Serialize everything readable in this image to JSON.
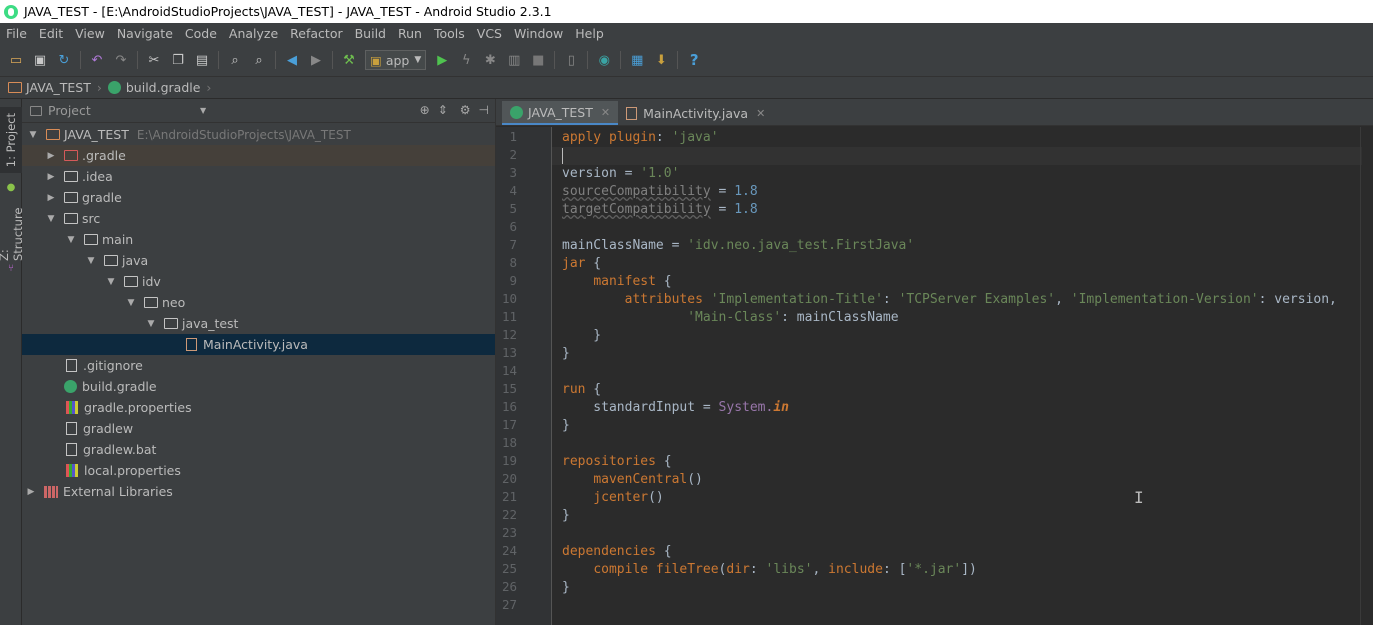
{
  "window": {
    "title": "JAVA_TEST - [E:\\AndroidStudioProjects\\JAVA_TEST] - JAVA_TEST - Android Studio 2.3.1"
  },
  "menu": [
    "File",
    "Edit",
    "View",
    "Navigate",
    "Code",
    "Analyze",
    "Refactor",
    "Build",
    "Run",
    "Tools",
    "VCS",
    "Window",
    "Help"
  ],
  "toolbar": {
    "run_config": "app",
    "help": "?"
  },
  "navbar": {
    "project": "JAVA_TEST",
    "file": "build.gradle"
  },
  "tool_strip": {
    "project_tab": "1: Project",
    "structure_tab": "Z: Structure"
  },
  "project_panel": {
    "view": "Project",
    "tree": [
      {
        "name": "JAVA_TEST",
        "path": "E:\\AndroidStudioProjects\\JAVA_TEST"
      },
      {
        "name": ".gradle"
      },
      {
        "name": ".idea"
      },
      {
        "name": "gradle"
      },
      {
        "name": "src"
      },
      {
        "name": "main"
      },
      {
        "name": "java"
      },
      {
        "name": "idv"
      },
      {
        "name": "neo"
      },
      {
        "name": "java_test"
      },
      {
        "name": "MainActivity.java"
      },
      {
        "name": ".gitignore"
      },
      {
        "name": "build.gradle"
      },
      {
        "name": "gradle.properties"
      },
      {
        "name": "gradlew"
      },
      {
        "name": "gradlew.bat"
      },
      {
        "name": "local.properties"
      },
      {
        "name": "External Libraries"
      }
    ]
  },
  "editor": {
    "tabs": [
      {
        "label": "JAVA_TEST",
        "active": true
      },
      {
        "label": "MainActivity.java",
        "active": false
      }
    ],
    "line_numbers": [
      "1",
      "2",
      "3",
      "4",
      "5",
      "6",
      "7",
      "8",
      "9",
      "10",
      "11",
      "12",
      "13",
      "14",
      "15",
      "16",
      "17",
      "18",
      "19",
      "20",
      "21",
      "22",
      "23",
      "24",
      "25",
      "26",
      "27"
    ],
    "code": [
      [
        [
          "k",
          "apply plugin"
        ],
        [
          "p",
          ": "
        ],
        [
          "s",
          "'java'"
        ]
      ],
      [],
      [
        [
          "p",
          "version = "
        ],
        [
          "s",
          "'1.0'"
        ]
      ],
      [
        [
          "u",
          "sourceCompatibility"
        ],
        [
          "p",
          " = "
        ],
        [
          "n",
          "1.8"
        ]
      ],
      [
        [
          "u",
          "targetCompatibility"
        ],
        [
          "p",
          " = "
        ],
        [
          "n",
          "1.8"
        ]
      ],
      [],
      [
        [
          "p",
          "mainClassName = "
        ],
        [
          "s",
          "'idv.neo.java_test.FirstJava'"
        ]
      ],
      [
        [
          "k",
          "jar"
        ],
        [
          "p",
          " {"
        ]
      ],
      [
        [
          "p",
          "    "
        ],
        [
          "k",
          "manifest"
        ],
        [
          "p",
          " {"
        ]
      ],
      [
        [
          "p",
          "        "
        ],
        [
          "k",
          "attributes "
        ],
        [
          "s",
          "'Implementation-Title'"
        ],
        [
          "p",
          ": "
        ],
        [
          "s",
          "'TCPServer Examples'"
        ],
        [
          "p",
          ", "
        ],
        [
          "s",
          "'Implementation-Version'"
        ],
        [
          "p",
          ": version,"
        ]
      ],
      [
        [
          "p",
          "                "
        ],
        [
          "s",
          "'Main-Class'"
        ],
        [
          "p",
          ": mainClassName"
        ]
      ],
      [
        [
          "p",
          "    }"
        ]
      ],
      [
        [
          "p",
          "}"
        ]
      ],
      [],
      [
        [
          "k",
          "run"
        ],
        [
          "p",
          " {"
        ]
      ],
      [
        [
          "p",
          "    standardInput = "
        ],
        [
          "m",
          "System."
        ],
        [
          "i",
          "in"
        ]
      ],
      [
        [
          "p",
          "}"
        ]
      ],
      [],
      [
        [
          "k",
          "repositories"
        ],
        [
          "p",
          " {"
        ]
      ],
      [
        [
          "p",
          "    "
        ],
        [
          "k",
          "mavenCentral"
        ],
        [
          "p",
          "()"
        ]
      ],
      [
        [
          "p",
          "    "
        ],
        [
          "k",
          "jcenter"
        ],
        [
          "p",
          "()"
        ]
      ],
      [
        [
          "p",
          "}"
        ]
      ],
      [],
      [
        [
          "k",
          "dependencies"
        ],
        [
          "p",
          " {"
        ]
      ],
      [
        [
          "p",
          "    "
        ],
        [
          "k",
          "compile fileTree"
        ],
        [
          "p",
          "("
        ],
        [
          "k",
          "dir"
        ],
        [
          "p",
          ": "
        ],
        [
          "s",
          "'libs'"
        ],
        [
          "p",
          ", "
        ],
        [
          "k",
          "include"
        ],
        [
          "p",
          ": ["
        ],
        [
          "s",
          "'*.jar'"
        ],
        [
          "p",
          "])"
        ]
      ],
      [
        [
          "p",
          "}"
        ]
      ],
      []
    ]
  }
}
